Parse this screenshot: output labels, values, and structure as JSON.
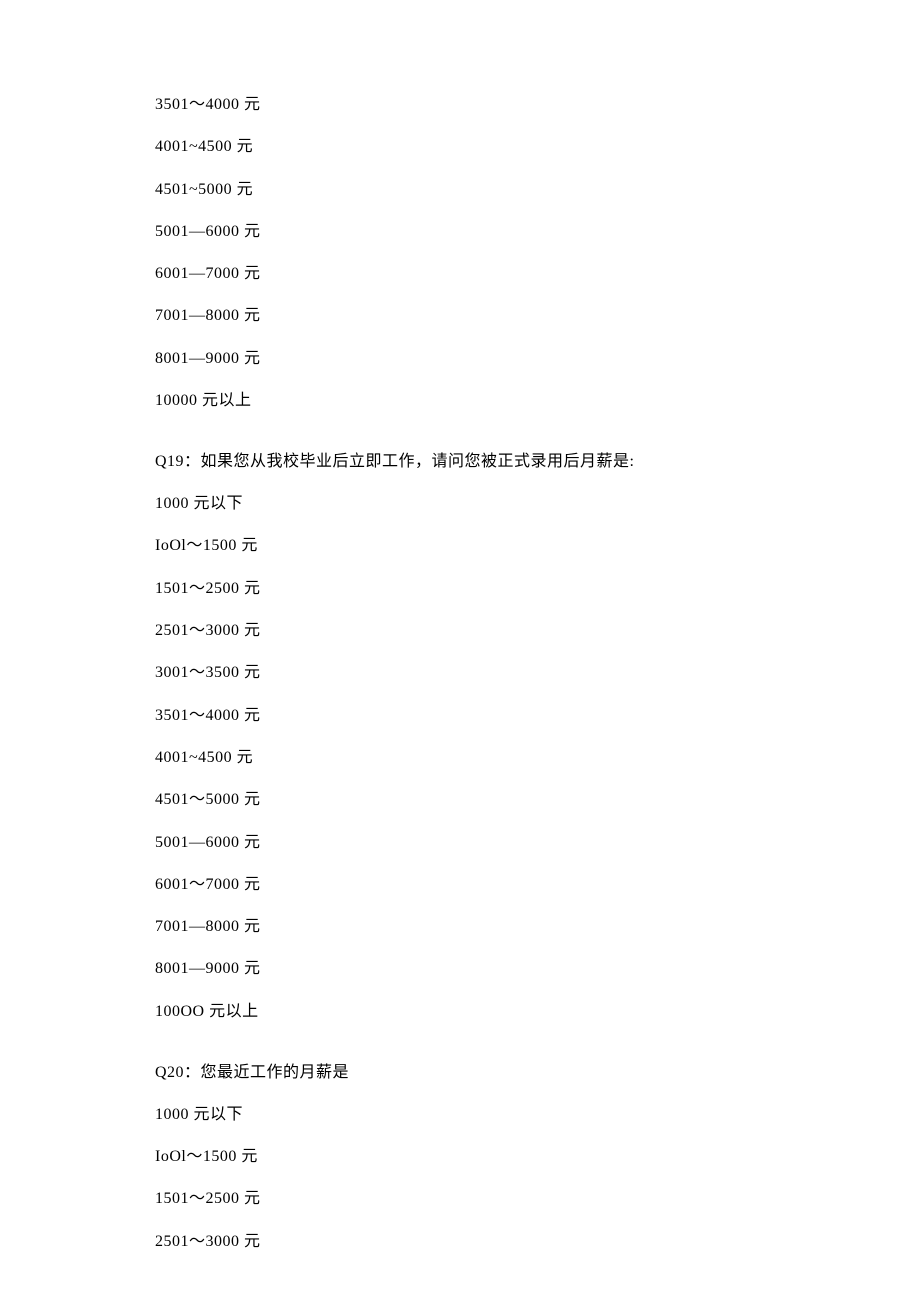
{
  "block1": {
    "options": [
      "3501～4000 元",
      "4001~4500 元",
      "4501~5000 元",
      "5001—6000 元",
      "6001—7000 元",
      "7001—8000 元",
      "8001—9000 元",
      "10000 元以上"
    ]
  },
  "q19": {
    "question": "Q19：如果您从我校毕业后立即工作，请问您被正式录用后月薪是:",
    "options": [
      "1000 元以下",
      "IoOl～1500 元",
      "1501～2500 元",
      "2501～3000 元",
      "3001～3500 元",
      "3501～4000 元",
      "4001~4500 元",
      "4501～5000 元",
      "5001—6000 元",
      "6001～7000 元",
      "7001—8000 元",
      "8001—9000 元",
      "100OO 元以上"
    ]
  },
  "q20": {
    "question": "Q20：您最近工作的月薪是",
    "options": [
      "1000 元以下",
      "IoOl～1500 元",
      "1501～2500 元",
      "2501～3000 元"
    ]
  }
}
